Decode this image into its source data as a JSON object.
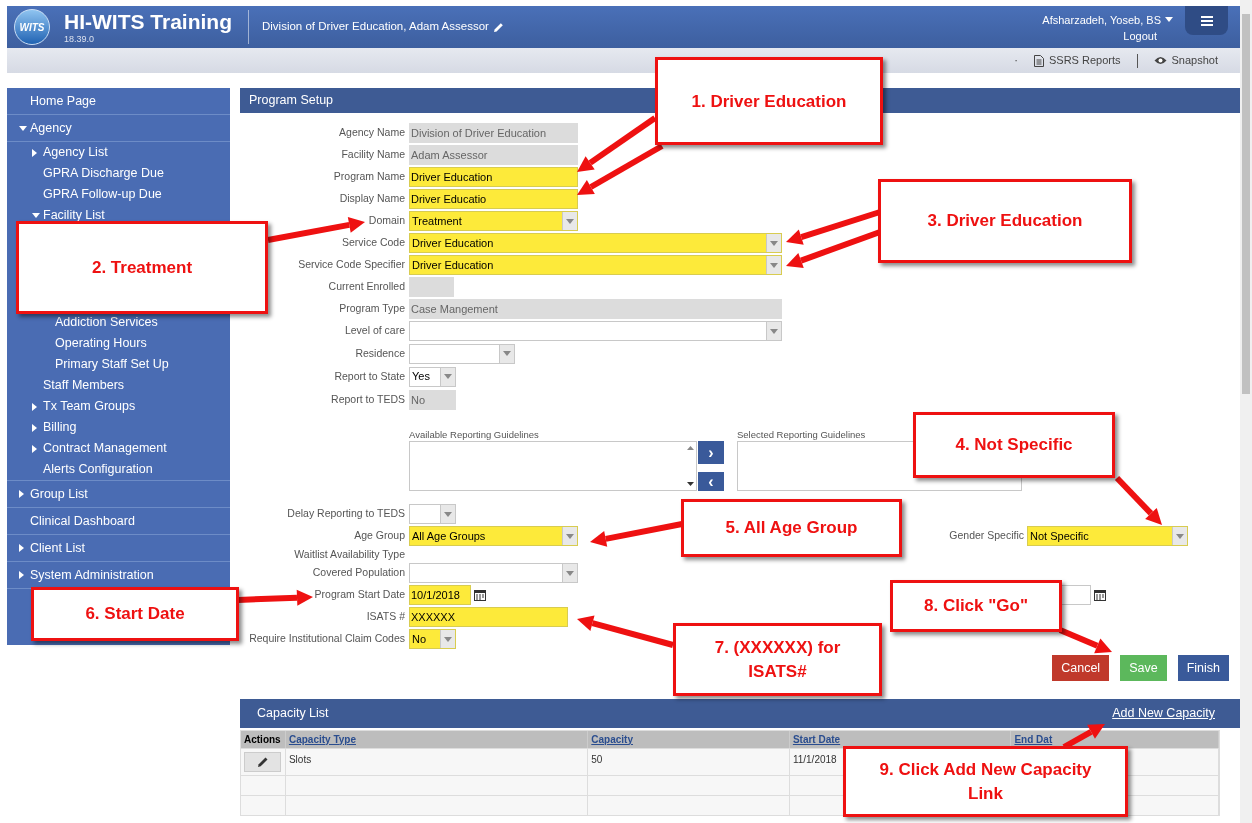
{
  "header": {
    "logo_text": "WITS",
    "app_title": "HI-WITS Training",
    "version": "18.39.0",
    "context": "Division of Driver Education, Adam Assessor",
    "user": "Afsharzadeh, Yoseb, BS",
    "logout": "Logout"
  },
  "toolbar": {
    "separator": "·",
    "links": [
      {
        "label": "SSRS Reports",
        "kind": "report"
      },
      {
        "label": "Snapshot",
        "kind": "eye"
      }
    ]
  },
  "sidebar": {
    "items": [
      {
        "label": "Home Page"
      },
      {
        "label": "Agency",
        "expanded": true,
        "children": [
          {
            "label": "Agency List",
            "expanded": false
          },
          {
            "label": "GPRA Discharge Due"
          },
          {
            "label": "GPRA Follow-up Due"
          },
          {
            "label": "Facility List",
            "expanded": true,
            "children": [
              {
                "label": "Addiction Services"
              },
              {
                "label": "Operating Hours"
              },
              {
                "label": "Primary Staff Set Up"
              }
            ]
          },
          {
            "label": "Staff Members"
          },
          {
            "label": "Tx Team Groups",
            "expanded": false
          },
          {
            "label": "Billing",
            "expanded": false
          },
          {
            "label": "Contract Management",
            "expanded": false
          },
          {
            "label": "Alerts Configuration"
          }
        ]
      },
      {
        "label": "Group List",
        "expanded": false
      },
      {
        "label": "Clinical Dashboard"
      },
      {
        "label": "Client List",
        "expanded": false
      },
      {
        "label": "System Administration",
        "expanded": false
      }
    ]
  },
  "program_setup": {
    "title": "Program Setup",
    "fields_top": [
      {
        "label": "Agency Name",
        "kind": "text",
        "value": "Division of Driver Education",
        "highlighted": false,
        "readonly": true
      },
      {
        "label": "Facility Name",
        "kind": "text",
        "value": "Adam Assessor",
        "highlighted": false,
        "readonly": true
      },
      {
        "label": "Program Name",
        "kind": "text",
        "value": "Driver Education",
        "highlighted": true,
        "readonly": false
      },
      {
        "label": "Display Name",
        "kind": "text",
        "value": "Driver Educatio",
        "highlighted": true,
        "readonly": false
      },
      {
        "label": "Domain",
        "kind": "select",
        "value": "Treatment",
        "highlighted": true,
        "readonly": false
      },
      {
        "label": "Service Code",
        "kind": "select",
        "value": "Driver Education",
        "highlighted": true,
        "readonly": false
      },
      {
        "label": "Service Code Specifier",
        "kind": "select",
        "value": "Driver Education",
        "highlighted": true,
        "readonly": false
      },
      {
        "label": "Current Enrolled",
        "kind": "text",
        "highlighted": false,
        "readonly": true
      },
      {
        "label": "Program Type",
        "kind": "text",
        "value": "Case Mangement",
        "highlighted": false,
        "readonly": true
      },
      {
        "label": "Level of care",
        "kind": "select",
        "highlighted": false,
        "readonly": false
      },
      {
        "label": "Residence",
        "kind": "select",
        "highlighted": false,
        "readonly": false
      },
      {
        "label": "Report to State",
        "kind": "select",
        "value": "Yes",
        "highlighted": false,
        "readonly": false
      },
      {
        "label": "Report to TEDS",
        "kind": "text",
        "value": "No",
        "highlighted": false,
        "readonly": true
      }
    ],
    "guidelines": {
      "available_label": "Available Reporting Guidelines",
      "selected_label": "Selected Reporting Guidelines",
      "add": "›",
      "remove": "‹"
    },
    "fields_bottom": [
      {
        "label": "Delay Reporting to TEDS",
        "kind": "select",
        "highlighted": false,
        "readonly": false
      },
      {
        "label": "Age Group",
        "kind": "select",
        "value": "All Age Groups",
        "highlighted": true,
        "readonly": false,
        "side": {
          "kind": "select",
          "label": "Gender Specific",
          "value": "Not Specific",
          "highlighted": true
        }
      },
      {
        "label": "Waitlist Availability Type",
        "kind": "label"
      },
      {
        "label": "Covered Population",
        "kind": "select",
        "highlighted": false,
        "readonly": false
      },
      {
        "label": "Program Start Date",
        "kind": "date",
        "value": "10/1/2018",
        "highlighted": true,
        "readonly": false,
        "side": {
          "kind": "date",
          "highlighted": false
        }
      },
      {
        "label": "ISATS #",
        "kind": "text",
        "value": "XXXXXX",
        "highlighted": true,
        "readonly": false
      },
      {
        "label": "Require Institutional Claim Codes",
        "kind": "select",
        "value": "No",
        "highlighted": true,
        "readonly": false
      }
    ],
    "buttons": [
      {
        "label": "Cancel",
        "kind": "danger"
      },
      {
        "label": "Save",
        "kind": "success"
      },
      {
        "label": "Finish",
        "kind": "primary"
      }
    ]
  },
  "capacity_list": {
    "title": "Capacity List",
    "link": "Add New Capacity",
    "columns": [
      "Actions",
      "Capacity Type",
      "Capacity",
      "Start Date",
      "End Dat"
    ],
    "rows": [
      {
        "editable": true,
        "cells": [
          "",
          "Slots",
          "50",
          "11/1/2018"
        ]
      }
    ]
  },
  "callouts": [
    {
      "text": "1. Driver Education"
    },
    {
      "text": "2. Treatment"
    },
    {
      "text": "3. Driver Education"
    },
    {
      "text": "4. Not Specific"
    },
    {
      "text": "5. All Age Group"
    },
    {
      "text": "6. Start Date"
    },
    {
      "text": "7. (XXXXXX) for ISATS#"
    },
    {
      "text": "8. Click \"Go\""
    },
    {
      "text": "9. Click Add New Capacity Link"
    }
  ]
}
